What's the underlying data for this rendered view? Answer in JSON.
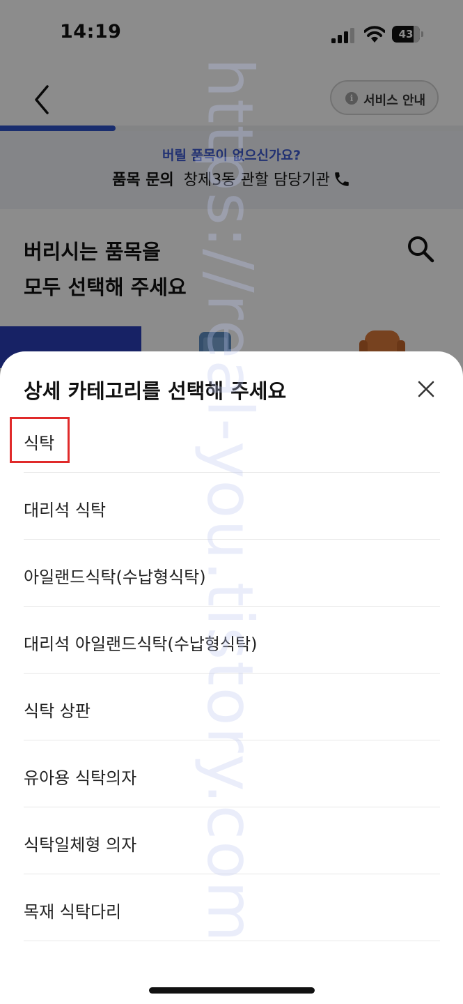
{
  "status_bar": {
    "time": "14:19",
    "battery": "43"
  },
  "header": {
    "service_label": "서비스 안내",
    "progress_fraction": 0.25
  },
  "banner": {
    "question": "버릴 품목이 없으신가요?",
    "inquiry_label": "품목 문의",
    "inquiry_text": "창제3동 관할 담당기관"
  },
  "page": {
    "title_line1": "버리시는 품목을",
    "title_line2": "모두 선택해 주세요"
  },
  "sheet": {
    "title": "상세 카테고리를 선택해 주세요",
    "options": [
      "식탁",
      "대리석 식탁",
      "아일랜드식탁(수납형식탁)",
      "대리석 아일랜드식탁(수납형식탁)",
      "식탁 상판",
      "유아용 식탁의자",
      "식탁일체형 의자",
      "목재 식탁다리"
    ]
  },
  "watermark": "https://real-you.tistory.com",
  "colors": {
    "accent_blue": "#2f53c8",
    "highlight_red": "#e02a2a",
    "banner_bg": "#f0f3f8"
  }
}
